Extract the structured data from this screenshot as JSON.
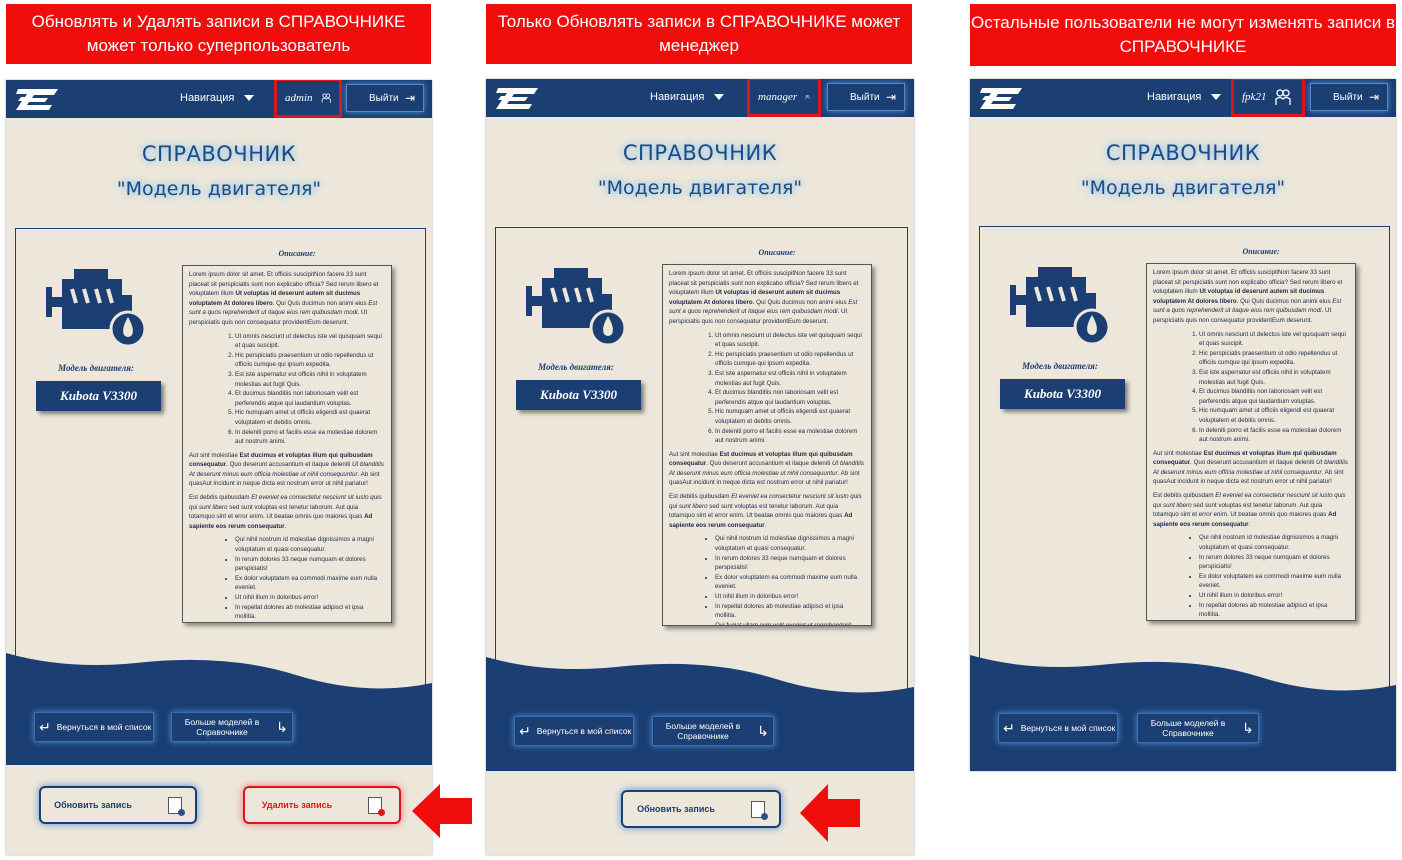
{
  "banners": [
    "Обновлять и Удалять записи в СПРАВОЧНИКЕ может только суперпользователь",
    "Только Обновлять записи в СПРАВОЧНИКЕ может менеджер",
    "Остальные пользователи не могут изменять записи в СПРАВОЧНИКЕ"
  ],
  "panels": [
    {
      "user": "admin",
      "update_label": "Обновить запись",
      "delete_label": "Удалить запись"
    },
    {
      "user": "manager",
      "update_label": "Обновить запись"
    },
    {
      "user": "fpk21"
    }
  ],
  "common": {
    "nav_label": "Навигация",
    "logout_label": "Выйти",
    "title": "СПРАВОЧНИК",
    "subtitle": "\"Модель двигателя\"",
    "model_caption": "Модель двигателя:",
    "model_name": "Kubota V3300",
    "desc_caption": "Описание:",
    "back_label": "Вернуться в мой список",
    "more_label": "Больше моделей в Справочнике"
  },
  "colors": {
    "header": "#1b3e73",
    "background": "#ece7da",
    "alert": "#f20d0d"
  }
}
